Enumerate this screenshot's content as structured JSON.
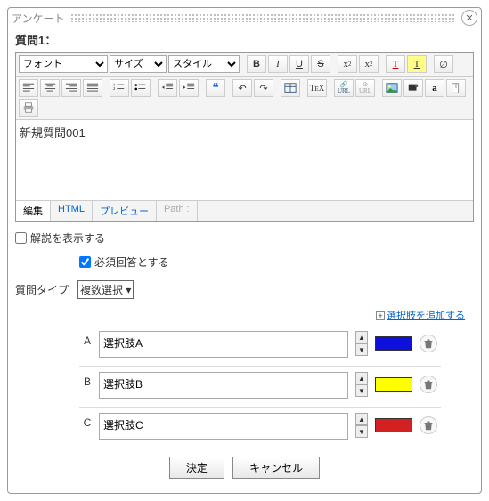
{
  "dialog": {
    "title": "アンケート"
  },
  "question": {
    "label": "質問1："
  },
  "editor": {
    "font_placeholder": "フォント",
    "size_placeholder": "サイズ",
    "style_placeholder": "スタイル",
    "content": "新規質問001",
    "tabs": {
      "edit": "編集",
      "html": "HTML",
      "preview": "プレビュー",
      "path": "Path :"
    }
  },
  "options": {
    "show_explanation": "解説を表示する",
    "show_explanation_checked": false,
    "required_answer": "必須回答とする",
    "required_answer_checked": true
  },
  "qtype": {
    "label": "質問タイプ",
    "selected": "複数選択"
  },
  "add_choice": "選択肢を追加する",
  "choices": [
    {
      "key": "A",
      "text": "選択肢A",
      "color": "#1010dd"
    },
    {
      "key": "B",
      "text": "選択肢B",
      "color": "#ffff00"
    },
    {
      "key": "C",
      "text": "選択肢C",
      "color": "#d32020"
    }
  ],
  "footer": {
    "ok": "決定",
    "cancel": "キャンセル"
  }
}
